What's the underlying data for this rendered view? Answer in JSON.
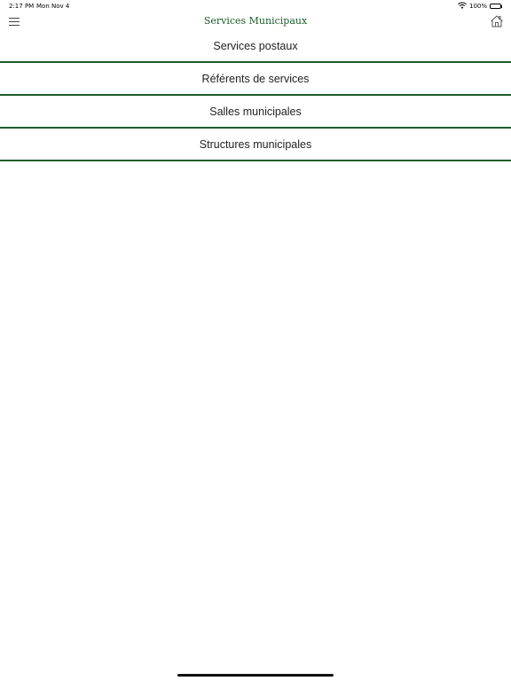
{
  "status_bar": {
    "time": "2:17 PM",
    "date": "Mon Nov 4",
    "battery": "100%",
    "wifi_icon": "wifi-icon",
    "battery_icon": "battery-icon"
  },
  "nav": {
    "title": "Services Municipaux",
    "menu_icon": "hamburger-menu-icon",
    "home_icon": "home-icon"
  },
  "menu_items": [
    {
      "label": "Services postaux"
    },
    {
      "label": "Référents de services"
    },
    {
      "label": "Salles municipales"
    },
    {
      "label": "Structures municipales"
    }
  ],
  "colors": {
    "accent": "#1c5c2a",
    "text": "#222222",
    "background": "#ffffff"
  }
}
